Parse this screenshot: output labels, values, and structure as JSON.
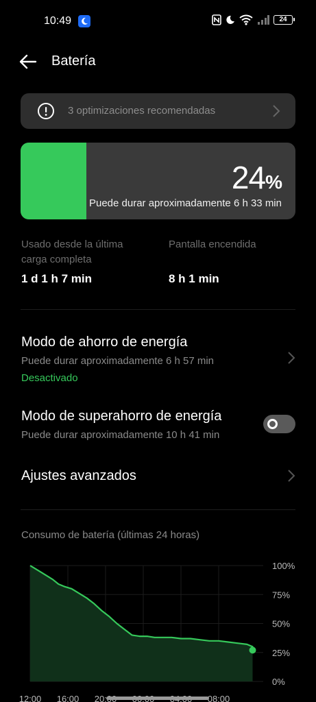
{
  "status_bar": {
    "time": "10:49",
    "battery_level": "24"
  },
  "header": {
    "title": "Batería"
  },
  "optimizations": {
    "label": "3 optimizaciones recomendadas"
  },
  "battery_card": {
    "percent_value": "24",
    "percent_sign": "%",
    "level_fraction": 0.24,
    "estimate": "Puede durar aproximadamente 6 h 33 min",
    "fill_color": "#36c95b"
  },
  "usage": {
    "since_charge_label_line1": "Usado desde la última",
    "since_charge_label_line2": "carga completa",
    "since_charge_value": "1 d 1 h 7 min",
    "screen_on_label": "Pantalla encendida",
    "screen_on_value": "8 h 1 min"
  },
  "power_saving": {
    "title": "Modo de ahorro de energía",
    "subtitle": "Puede durar aproximadamente 6 h 57 min",
    "status": "Desactivado"
  },
  "super_saving": {
    "title": "Modo de superahorro de energía",
    "subtitle": "Puede durar aproximadamente 10 h 41 min",
    "enabled": false
  },
  "advanced": {
    "title": "Ajustes avanzados"
  },
  "chart_title": "Consumo de batería (últimas 24 horas)",
  "chart_data": {
    "type": "area",
    "title": "Consumo de batería (últimas 24 horas)",
    "x_ticks": [
      "12:00",
      "16:00",
      "20:00",
      "00:00",
      "04:00",
      "08:00"
    ],
    "y_ticks": [
      "100%",
      "75%",
      "50%",
      "25%",
      "0%"
    ],
    "ylim": [
      0,
      100
    ],
    "x_hours": [
      0,
      0.6,
      1.2,
      1.8,
      2.4,
      3.0,
      3.6,
      4.4,
      5.2,
      6.0,
      6.8,
      7.6,
      8.4,
      9.2,
      10.0,
      10.8,
      11.6,
      12.4,
      13.2,
      14.0,
      15.0,
      16.0,
      17.0,
      18.0,
      19.0,
      20.0,
      21.0,
      22.0,
      23.0,
      23.6
    ],
    "y_values": [
      100,
      97,
      94,
      91,
      88,
      84,
      82,
      80,
      76,
      72,
      67,
      61,
      56,
      50,
      45,
      40,
      39,
      39,
      38,
      38,
      38,
      37,
      37,
      36,
      35,
      35,
      34,
      33,
      32,
      30
    ],
    "current_point": {
      "x": 23.6,
      "y": 27
    },
    "line_color": "#36c95b",
    "fill_color": "#10301a",
    "grid": true
  }
}
